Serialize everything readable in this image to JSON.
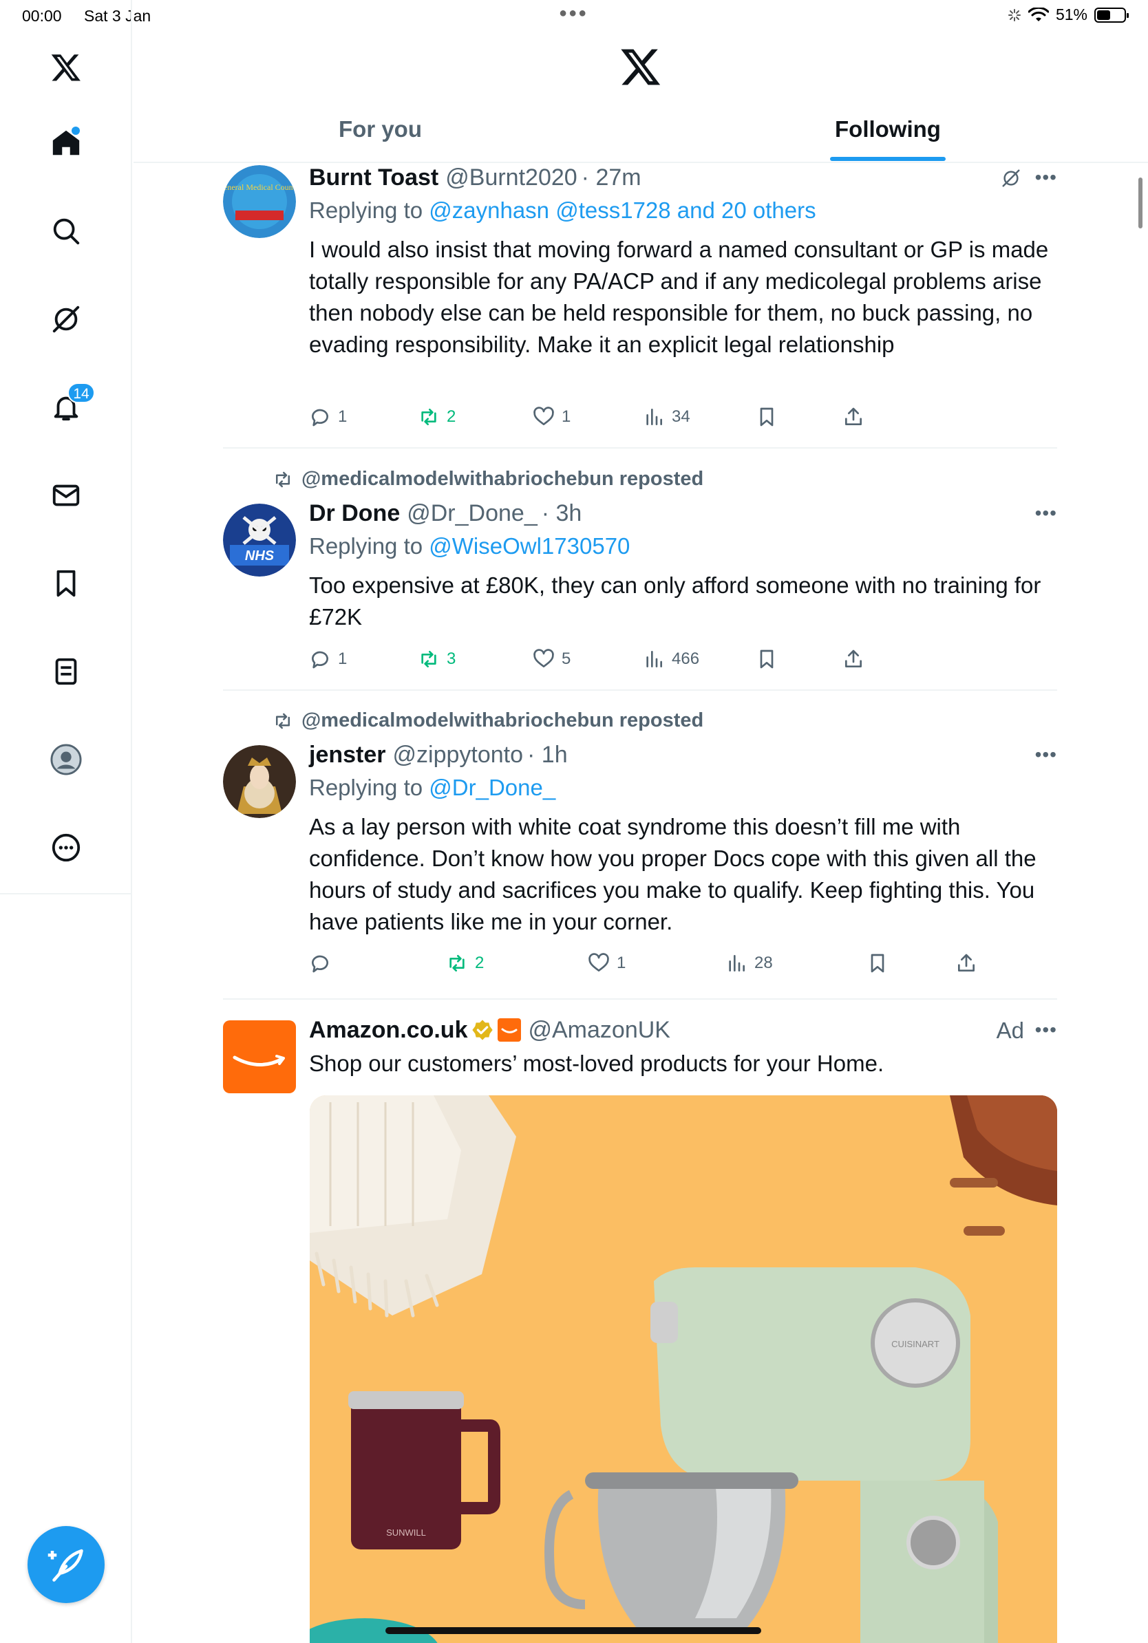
{
  "status_bar": {
    "time": "00:00",
    "date": "Sat 3 Jan",
    "battery": "51%",
    "battery_level": 0.51
  },
  "sidebar": {
    "items": [
      {
        "name": "home",
        "icon": "home-icon"
      },
      {
        "name": "explore",
        "icon": "search-icon"
      },
      {
        "name": "grok",
        "icon": "grok-icon"
      },
      {
        "name": "notifications",
        "icon": "bell-icon",
        "badge": "14"
      },
      {
        "name": "messages",
        "icon": "mail-icon"
      },
      {
        "name": "bookmarks",
        "icon": "bookmark-icon"
      },
      {
        "name": "lists",
        "icon": "list-icon"
      },
      {
        "name": "profile",
        "icon": "avatar-icon"
      },
      {
        "name": "more",
        "icon": "more-circle-icon"
      }
    ],
    "compose_icon": "compose-feather-icon"
  },
  "tabs": [
    {
      "label": "For you",
      "active": false
    },
    {
      "label": "Following",
      "active": true
    }
  ],
  "tweets": [
    {
      "name": "Burnt Toast",
      "handle": "@Burnt2020",
      "time": "· 27m",
      "replying_prefix": "Replying to ",
      "replying_to": "@zaynhasn @tess1728 and 20 others",
      "text": "I would also insist that moving forward a named consultant or GP is made totally responsible for any PA/ACP and if any medicolegal problems arise then nobody else can be held responsible for them, no buck passing, no evading responsibility. Make it an explicit legal relationship",
      "replies": "1",
      "reposts": "2",
      "likes": "1",
      "views": "34"
    },
    {
      "reposted_by": "@medicalmodelwithabriochebun reposted",
      "name": "Dr Done",
      "handle": "@Dr_Done_",
      "time": "· 3h",
      "replying_prefix": "Replying to ",
      "replying_to": "@WiseOwl1730570",
      "text": "Too expensive at £80K, they can only afford someone with no training for £72K",
      "replies": "1",
      "reposts": "3",
      "likes": "5",
      "views": "466"
    },
    {
      "reposted_by": "@medicalmodelwithabriochebun reposted",
      "name": "jenster",
      "handle": "@zippytonto",
      "time": "· 1h",
      "replying_prefix": "Replying to ",
      "replying_to": "@Dr_Done_",
      "text": "As a lay person with white coat syndrome this doesn’t fill me with confidence. Don’t know how you proper Docs cope with this given all the hours of study and sacrifices you make to qualify. Keep fighting this. You have patients like me in your corner.",
      "replies": "",
      "reposts": "2",
      "likes": "1",
      "views": "28"
    }
  ],
  "ad": {
    "name": "Amazon.co.uk",
    "handle": "@AmazonUK",
    "label": "Ad",
    "text": "Shop our customers’ most-loved products for your Home.",
    "mug_brand": "SUNWILL",
    "mixer_brand": "CUISINART"
  },
  "avatar_texts": {
    "burnt_toast": "General Medical Council",
    "dr_done": "NHS"
  },
  "colors": {
    "accent": "#1d9bf0",
    "repost_green": "#00ba7c",
    "secondary_text": "#536471",
    "ad_orange": "#ff6b0b",
    "ad_background": "#fbbe63"
  }
}
